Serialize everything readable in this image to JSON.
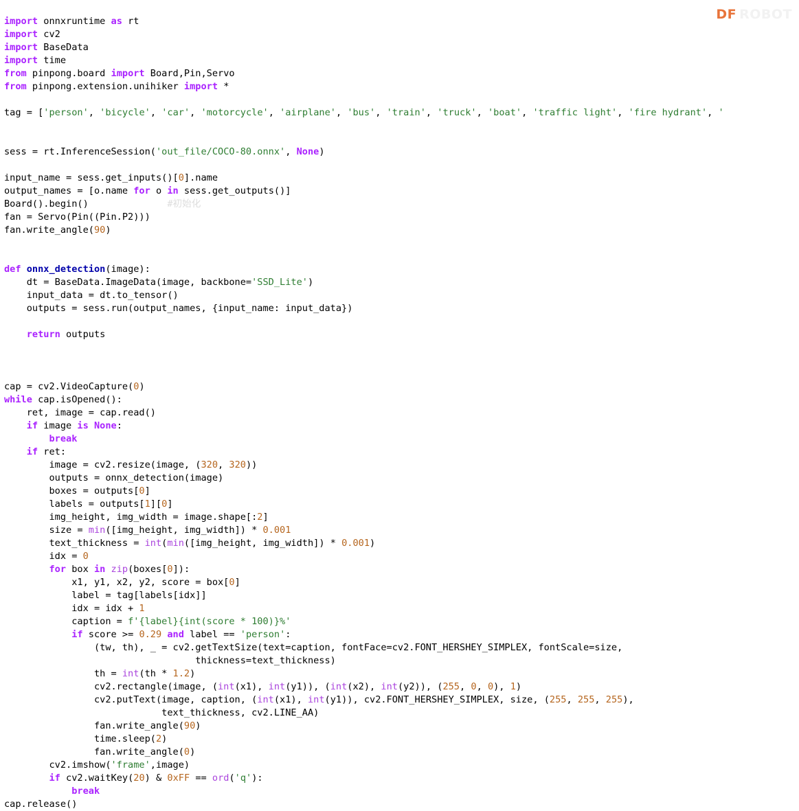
{
  "watermark": {
    "mark": "DF",
    "ghost": "ROBOT"
  },
  "editor": {
    "language": "python",
    "background_color": "#ffffff",
    "font_family": "monospace",
    "font_size_px": 13.6,
    "line_height_px": 19
  },
  "theme_colors": {
    "keyword": "#aa22ff",
    "builtin": "#aa44dd",
    "function_name": "#0000aa",
    "string": "#2e7d32",
    "number": "#b5651d",
    "comment": "#dddddd",
    "text": "#000000",
    "watermark_accent": "#e8743b"
  },
  "code": {
    "lines": [
      [
        {
          "t": "import",
          "c": "k"
        },
        {
          "t": " onnxruntime ",
          "c": "n"
        },
        {
          "t": "as",
          "c": "k"
        },
        {
          "t": " rt",
          "c": "n"
        }
      ],
      [
        {
          "t": "import",
          "c": "k"
        },
        {
          "t": " cv2",
          "c": "n"
        }
      ],
      [
        {
          "t": "import",
          "c": "k"
        },
        {
          "t": " BaseData",
          "c": "n"
        }
      ],
      [
        {
          "t": "import",
          "c": "k"
        },
        {
          "t": " time",
          "c": "n"
        }
      ],
      [
        {
          "t": "from",
          "c": "k"
        },
        {
          "t": " pinpong.board ",
          "c": "n"
        },
        {
          "t": "import",
          "c": "k"
        },
        {
          "t": " Board,Pin,Servo",
          "c": "n"
        }
      ],
      [
        {
          "t": "from",
          "c": "k"
        },
        {
          "t": " pinpong.extension.unihiker ",
          "c": "n"
        },
        {
          "t": "import",
          "c": "k"
        },
        {
          "t": " *",
          "c": "o"
        }
      ],
      [],
      [
        {
          "t": "tag = [",
          "c": "n"
        },
        {
          "t": "'person'",
          "c": "s"
        },
        {
          "t": ", ",
          "c": "n"
        },
        {
          "t": "'bicycle'",
          "c": "s"
        },
        {
          "t": ", ",
          "c": "n"
        },
        {
          "t": "'car'",
          "c": "s"
        },
        {
          "t": ", ",
          "c": "n"
        },
        {
          "t": "'motorcycle'",
          "c": "s"
        },
        {
          "t": ", ",
          "c": "n"
        },
        {
          "t": "'airplane'",
          "c": "s"
        },
        {
          "t": ", ",
          "c": "n"
        },
        {
          "t": "'bus'",
          "c": "s"
        },
        {
          "t": ", ",
          "c": "n"
        },
        {
          "t": "'train'",
          "c": "s"
        },
        {
          "t": ", ",
          "c": "n"
        },
        {
          "t": "'truck'",
          "c": "s"
        },
        {
          "t": ", ",
          "c": "n"
        },
        {
          "t": "'boat'",
          "c": "s"
        },
        {
          "t": ", ",
          "c": "n"
        },
        {
          "t": "'traffic light'",
          "c": "s"
        },
        {
          "t": ", ",
          "c": "n"
        },
        {
          "t": "'fire hydrant'",
          "c": "s"
        },
        {
          "t": ", ",
          "c": "n"
        },
        {
          "t": "'",
          "c": "s"
        }
      ],
      [],
      [],
      [
        {
          "t": "sess = rt.InferenceSession(",
          "c": "n"
        },
        {
          "t": "'out_file/COCO-80.onnx'",
          "c": "s"
        },
        {
          "t": ", ",
          "c": "n"
        },
        {
          "t": "None",
          "c": "kc"
        },
        {
          "t": ")",
          "c": "n"
        }
      ],
      [],
      [
        {
          "t": "input_name = sess.get_inputs()[",
          "c": "n"
        },
        {
          "t": "0",
          "c": "m"
        },
        {
          "t": "].name",
          "c": "n"
        }
      ],
      [
        {
          "t": "output_names = [o.name ",
          "c": "n"
        },
        {
          "t": "for",
          "c": "k"
        },
        {
          "t": " o ",
          "c": "n"
        },
        {
          "t": "in",
          "c": "k"
        },
        {
          "t": " sess.get_outputs()]",
          "c": "n"
        }
      ],
      [
        {
          "t": "Board().begin()              ",
          "c": "n"
        },
        {
          "t": "#初始化",
          "c": "c"
        }
      ],
      [
        {
          "t": "fan = Servo(Pin((Pin.P2)))",
          "c": "n"
        }
      ],
      [
        {
          "t": "fan.write_angle(",
          "c": "n"
        },
        {
          "t": "90",
          "c": "m"
        },
        {
          "t": ")",
          "c": "n"
        }
      ],
      [],
      [],
      [
        {
          "t": "def",
          "c": "k"
        },
        {
          "t": " ",
          "c": "n"
        },
        {
          "t": "onnx_detection",
          "c": "nf"
        },
        {
          "t": "(image):",
          "c": "n"
        }
      ],
      [
        {
          "t": "    dt = BaseData.ImageData(image, backbone=",
          "c": "n"
        },
        {
          "t": "'SSD_Lite'",
          "c": "s"
        },
        {
          "t": ")",
          "c": "n"
        }
      ],
      [
        {
          "t": "    input_data = dt.to_tensor()",
          "c": "n"
        }
      ],
      [
        {
          "t": "    outputs = sess.run(output_names, {input_name: input_data})",
          "c": "n"
        }
      ],
      [],
      [
        {
          "t": "    ",
          "c": "n"
        },
        {
          "t": "return",
          "c": "k"
        },
        {
          "t": " outputs",
          "c": "n"
        }
      ],
      [],
      [],
      [],
      [
        {
          "t": "cap = cv2.VideoCapture(",
          "c": "n"
        },
        {
          "t": "0",
          "c": "m"
        },
        {
          "t": ")",
          "c": "n"
        }
      ],
      [
        {
          "t": "while",
          "c": "k"
        },
        {
          "t": " cap.isOpened():",
          "c": "n"
        }
      ],
      [
        {
          "t": "    ret, image = cap.read()",
          "c": "n"
        }
      ],
      [
        {
          "t": "    ",
          "c": "n"
        },
        {
          "t": "if",
          "c": "k"
        },
        {
          "t": " image ",
          "c": "n"
        },
        {
          "t": "is",
          "c": "k"
        },
        {
          "t": " ",
          "c": "n"
        },
        {
          "t": "None",
          "c": "kc"
        },
        {
          "t": ":",
          "c": "n"
        }
      ],
      [
        {
          "t": "        ",
          "c": "n"
        },
        {
          "t": "break",
          "c": "k"
        }
      ],
      [
        {
          "t": "    ",
          "c": "n"
        },
        {
          "t": "if",
          "c": "k"
        },
        {
          "t": " ret:",
          "c": "n"
        }
      ],
      [
        {
          "t": "        image = cv2.resize(image, (",
          "c": "n"
        },
        {
          "t": "320",
          "c": "m"
        },
        {
          "t": ", ",
          "c": "n"
        },
        {
          "t": "320",
          "c": "m"
        },
        {
          "t": "))",
          "c": "n"
        }
      ],
      [
        {
          "t": "        outputs = onnx_detection(image)",
          "c": "n"
        }
      ],
      [
        {
          "t": "        boxes = outputs[",
          "c": "n"
        },
        {
          "t": "0",
          "c": "m"
        },
        {
          "t": "]",
          "c": "n"
        }
      ],
      [
        {
          "t": "        labels = outputs[",
          "c": "n"
        },
        {
          "t": "1",
          "c": "m"
        },
        {
          "t": "][",
          "c": "n"
        },
        {
          "t": "0",
          "c": "m"
        },
        {
          "t": "]",
          "c": "n"
        }
      ],
      [
        {
          "t": "        img_height, img_width = image.shape[:",
          "c": "n"
        },
        {
          "t": "2",
          "c": "m"
        },
        {
          "t": "]",
          "c": "n"
        }
      ],
      [
        {
          "t": "        size = ",
          "c": "n"
        },
        {
          "t": "min",
          "c": "nb"
        },
        {
          "t": "([img_height, img_width]) * ",
          "c": "n"
        },
        {
          "t": "0.001",
          "c": "m"
        }
      ],
      [
        {
          "t": "        text_thickness = ",
          "c": "n"
        },
        {
          "t": "int",
          "c": "nb"
        },
        {
          "t": "(",
          "c": "n"
        },
        {
          "t": "min",
          "c": "nb"
        },
        {
          "t": "([img_height, img_width]) * ",
          "c": "n"
        },
        {
          "t": "0.001",
          "c": "m"
        },
        {
          "t": ")",
          "c": "n"
        }
      ],
      [
        {
          "t": "        idx = ",
          "c": "n"
        },
        {
          "t": "0",
          "c": "m"
        }
      ],
      [
        {
          "t": "        ",
          "c": "n"
        },
        {
          "t": "for",
          "c": "k"
        },
        {
          "t": " box ",
          "c": "n"
        },
        {
          "t": "in",
          "c": "k"
        },
        {
          "t": " ",
          "c": "n"
        },
        {
          "t": "zip",
          "c": "nb"
        },
        {
          "t": "(boxes[",
          "c": "n"
        },
        {
          "t": "0",
          "c": "m"
        },
        {
          "t": "]):",
          "c": "n"
        }
      ],
      [
        {
          "t": "            x1, y1, x2, y2, score = box[",
          "c": "n"
        },
        {
          "t": "0",
          "c": "m"
        },
        {
          "t": "]",
          "c": "n"
        }
      ],
      [
        {
          "t": "            label = tag[labels[idx]]",
          "c": "n"
        }
      ],
      [
        {
          "t": "            idx = idx + ",
          "c": "n"
        },
        {
          "t": "1",
          "c": "m"
        }
      ],
      [
        {
          "t": "            caption = ",
          "c": "n"
        },
        {
          "t": "f'{label}{int(score * 100)}%'",
          "c": "s"
        }
      ],
      [
        {
          "t": "            ",
          "c": "n"
        },
        {
          "t": "if",
          "c": "k"
        },
        {
          "t": " score >= ",
          "c": "n"
        },
        {
          "t": "0.29",
          "c": "m"
        },
        {
          "t": " ",
          "c": "n"
        },
        {
          "t": "and",
          "c": "k"
        },
        {
          "t": " label == ",
          "c": "n"
        },
        {
          "t": "'person'",
          "c": "s"
        },
        {
          "t": ":",
          "c": "n"
        }
      ],
      [
        {
          "t": "                (tw, th), _ = cv2.getTextSize(text=caption, fontFace=cv2.FONT_HERSHEY_SIMPLEX, fontScale=size,",
          "c": "n"
        }
      ],
      [
        {
          "t": "                                  thickness=text_thickness)",
          "c": "n"
        }
      ],
      [
        {
          "t": "                th = ",
          "c": "n"
        },
        {
          "t": "int",
          "c": "nb"
        },
        {
          "t": "(th * ",
          "c": "n"
        },
        {
          "t": "1.2",
          "c": "m"
        },
        {
          "t": ")",
          "c": "n"
        }
      ],
      [
        {
          "t": "                cv2.rectangle(image, (",
          "c": "n"
        },
        {
          "t": "int",
          "c": "nb"
        },
        {
          "t": "(x1), ",
          "c": "n"
        },
        {
          "t": "int",
          "c": "nb"
        },
        {
          "t": "(y1)), (",
          "c": "n"
        },
        {
          "t": "int",
          "c": "nb"
        },
        {
          "t": "(x2), ",
          "c": "n"
        },
        {
          "t": "int",
          "c": "nb"
        },
        {
          "t": "(y2)), (",
          "c": "n"
        },
        {
          "t": "255",
          "c": "m"
        },
        {
          "t": ", ",
          "c": "n"
        },
        {
          "t": "0",
          "c": "m"
        },
        {
          "t": ", ",
          "c": "n"
        },
        {
          "t": "0",
          "c": "m"
        },
        {
          "t": "), ",
          "c": "n"
        },
        {
          "t": "1",
          "c": "m"
        },
        {
          "t": ")",
          "c": "n"
        }
      ],
      [
        {
          "t": "                cv2.putText(image, caption, (",
          "c": "n"
        },
        {
          "t": "int",
          "c": "nb"
        },
        {
          "t": "(x1), ",
          "c": "n"
        },
        {
          "t": "int",
          "c": "nb"
        },
        {
          "t": "(y1)), cv2.FONT_HERSHEY_SIMPLEX, size, (",
          "c": "n"
        },
        {
          "t": "255",
          "c": "m"
        },
        {
          "t": ", ",
          "c": "n"
        },
        {
          "t": "255",
          "c": "m"
        },
        {
          "t": ", ",
          "c": "n"
        },
        {
          "t": "255",
          "c": "m"
        },
        {
          "t": "),",
          "c": "n"
        }
      ],
      [
        {
          "t": "                            text_thickness, cv2.LINE_AA)",
          "c": "n"
        }
      ],
      [
        {
          "t": "                fan.write_angle(",
          "c": "n"
        },
        {
          "t": "90",
          "c": "m"
        },
        {
          "t": ")",
          "c": "n"
        }
      ],
      [
        {
          "t": "                time.sleep(",
          "c": "n"
        },
        {
          "t": "2",
          "c": "m"
        },
        {
          "t": ")",
          "c": "n"
        }
      ],
      [
        {
          "t": "                fan.write_angle(",
          "c": "n"
        },
        {
          "t": "0",
          "c": "m"
        },
        {
          "t": ")",
          "c": "n"
        }
      ],
      [
        {
          "t": "        cv2.imshow(",
          "c": "n"
        },
        {
          "t": "'frame'",
          "c": "s"
        },
        {
          "t": ",image)",
          "c": "n"
        }
      ],
      [
        {
          "t": "        ",
          "c": "n"
        },
        {
          "t": "if",
          "c": "k"
        },
        {
          "t": " cv2.waitKey(",
          "c": "n"
        },
        {
          "t": "20",
          "c": "m"
        },
        {
          "t": ") & ",
          "c": "n"
        },
        {
          "t": "0xFF",
          "c": "m"
        },
        {
          "t": " == ",
          "c": "n"
        },
        {
          "t": "ord",
          "c": "nb"
        },
        {
          "t": "(",
          "c": "n"
        },
        {
          "t": "'q'",
          "c": "s"
        },
        {
          "t": "):",
          "c": "n"
        }
      ],
      [
        {
          "t": "            ",
          "c": "n"
        },
        {
          "t": "break",
          "c": "k"
        }
      ],
      [
        {
          "t": "cap.release()",
          "c": "n"
        }
      ]
    ]
  }
}
